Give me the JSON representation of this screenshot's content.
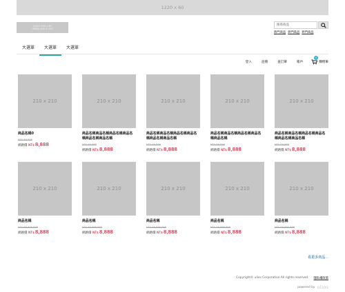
{
  "banner": {
    "label": "1220 x 60"
  },
  "logo": {
    "line1": "LOGO 500 x 60",
    "line2": "HRWA 400 X 150"
  },
  "search": {
    "placeholder": "搜尋商品",
    "hot_links": [
      "熱門商品",
      "熱門商品",
      "熱門商品"
    ]
  },
  "nav": {
    "tabs": [
      {
        "label": "大選單"
      },
      {
        "label": "大選單"
      },
      {
        "label": "大選單"
      }
    ]
  },
  "user_bar": {
    "login": "登入",
    "register": "註冊",
    "orders": "查訂單",
    "account": "帳戶",
    "cart_label": "購物車",
    "cart_count": "0"
  },
  "products": [
    {
      "thumb": "210 x 210",
      "name": "商品名稱0",
      "orig": "NT$ 88,888",
      "prefix": "網路價",
      "currency": "NT$",
      "price": "8,888"
    },
    {
      "thumb": "210 x 210",
      "name": "商品名稱商品名稱商品名稱商品名稱商品名稱商品名稱",
      "orig": "NT$ 88,888",
      "prefix": "網路價",
      "currency": "NT$",
      "price": "8,888"
    },
    {
      "thumb": "210 x 210",
      "name": "商品名稱商品名稱商品名稱商品名稱商品名稱商品名稱",
      "orig": "NT$ 88,888",
      "prefix": "網路價",
      "currency": "NT$",
      "price": "8,888"
    },
    {
      "thumb": "210 x 210",
      "name": "商品名稱商品名稱商品名稱商品名稱商品名稱",
      "orig": "NT$ 88,888",
      "prefix": "網路價",
      "currency": "NT$",
      "price": "8,888"
    },
    {
      "thumb": "210 x 210",
      "name": "商品名稱商品名稱商品名稱商品名稱商品名稱商品名稱",
      "orig": "NT$ 88,888",
      "prefix": "網路價",
      "currency": "NT$",
      "price": "8,888"
    },
    {
      "thumb": "210 x 210",
      "name": "商品名稱",
      "orig": "NT$ 88,888,888",
      "prefix": "網路價",
      "currency": "NT$",
      "price": "8,888"
    },
    {
      "thumb": "210 x 210",
      "name": "商品名稱",
      "orig": "NT$ 88,888,888",
      "prefix": "網路價",
      "currency": "NT$",
      "price": "8,888"
    },
    {
      "thumb": "210 x 210",
      "name": "商品名稱",
      "orig": "NT$ 88,888,888",
      "prefix": "網路價",
      "currency": "NT$",
      "price": "8,888"
    },
    {
      "thumb": "210 x 210",
      "name": "商品名稱",
      "orig": "NT$ 88,888,888",
      "prefix": "網路價",
      "currency": "NT$",
      "price": "8,888"
    },
    {
      "thumb": "210 x 210",
      "name": "商品名稱",
      "orig": "NT$ 88,888,888",
      "prefix": "網路價",
      "currency": "NT$",
      "price": "8,888"
    }
  ],
  "more_link": "看更多商品...",
  "footer": {
    "copyright": "Copyright© ulios Corporation All rights reserved.",
    "privacy": "隱私權政策",
    "powered_by": "powered by",
    "powered_brand": "ulios"
  },
  "colors": {
    "accent": "#2aa7a1",
    "price": "#d0021b",
    "link": "#2a7ab8",
    "badge": "#25b5d3"
  }
}
